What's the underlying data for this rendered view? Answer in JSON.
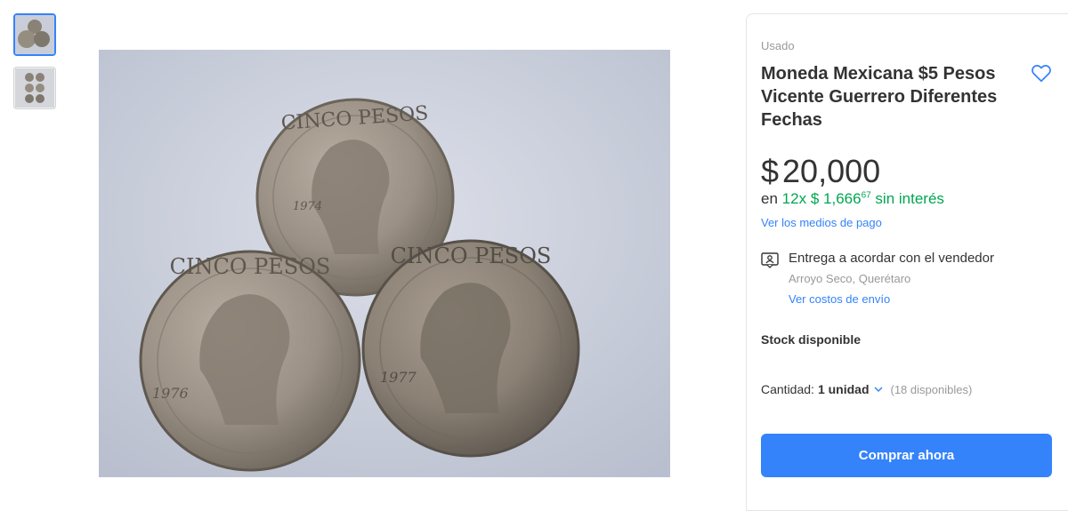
{
  "gallery": {
    "thumbnails": [
      {
        "icon": "coins-photo-thumbnail",
        "active": true
      },
      {
        "icon": "coins-grid-thumbnail",
        "active": false
      }
    ],
    "main_image_icon": "three-coins-photo",
    "coins": [
      {
        "legend": "CINCO PESOS",
        "year": "1974"
      },
      {
        "legend": "CINCO PESOS",
        "year": "1976"
      },
      {
        "legend": "CINCO PESOS",
        "year": "1977"
      }
    ]
  },
  "product": {
    "condition": "Usado",
    "title": "Moneda Mexicana $5 Pesos Vicente Guerrero Diferentes Fechas",
    "favorite_icon": "heart-icon",
    "price": {
      "currency": "$",
      "amount": "20,000"
    },
    "installments": {
      "prefix": "en",
      "count": "12x",
      "currency": "$",
      "amount": "1,666",
      "cents": "67",
      "suffix": "sin interés"
    },
    "payment_link": "Ver los medios de pago"
  },
  "shipping": {
    "icon": "meeting-pickup-icon",
    "title": "Entrega a acordar con el vendedor",
    "location": "Arroyo Seco, Querétaro",
    "link": "Ver costos de envío"
  },
  "stock": {
    "label": "Stock disponible",
    "quantity_label": "Cantidad:",
    "quantity_value": "1 unidad",
    "available": "(18 disponibles)"
  },
  "actions": {
    "buy_now": "Comprar ahora"
  },
  "colors": {
    "accent": "#3483fa",
    "green": "#00a650"
  }
}
